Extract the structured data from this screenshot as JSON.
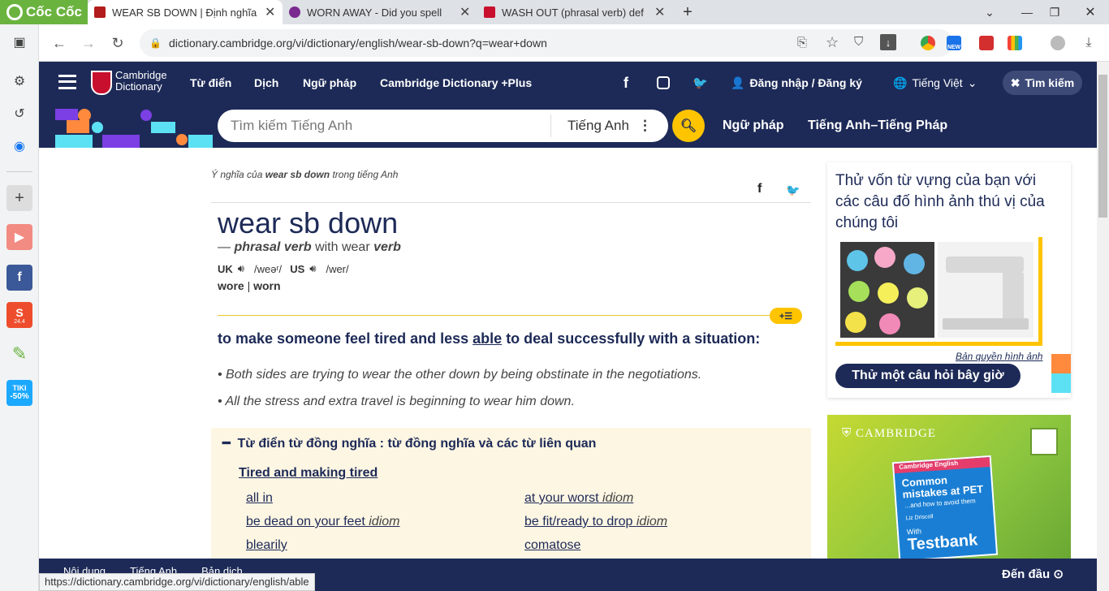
{
  "browser": {
    "brand": "Cốc Cốc",
    "tabs": [
      {
        "title": "WEAR SB DOWN | Định nghĩa"
      },
      {
        "title": "WORN AWAY - Did you spell"
      },
      {
        "title": "WASH OUT (phrasal verb) def"
      }
    ],
    "url": "dictionary.cambridge.org/vi/dictionary/english/wear-sb-down?q=wear+down",
    "status_url": "https://dictionary.cambridge.org/vi/dictionary/english/able",
    "ext_new_badge": "NEW"
  },
  "sidebar": {
    "shopee_badge": "24.4",
    "tiki_label": "TIKI",
    "tiki_discount": "-50%"
  },
  "header": {
    "brand_line1": "Cambridge",
    "brand_line2": "Dictionary",
    "nav": [
      "Từ điển",
      "Dịch",
      "Ngữ pháp",
      "Cambridge Dictionary +Plus"
    ],
    "login": "Đăng nhập / Đăng ký",
    "language": "Tiếng Việt",
    "search_toggle": "Tìm kiếm"
  },
  "subheader": {
    "search_placeholder": "Tìm kiếm Tiếng Anh",
    "dictionary_select": "Tiếng Anh",
    "links": [
      "Ngữ pháp",
      "Tiếng Anh–Tiếng Pháp"
    ]
  },
  "entry": {
    "breadcrumb_prefix": "Ý nghĩa của",
    "breadcrumb_word": "wear sb down",
    "breadcrumb_suffix": "trong tiếng Anh",
    "headword": "wear sb down",
    "dash": "—",
    "pos": "phrasal verb",
    "with_text": "with wear",
    "with_pos": "verb",
    "uk_label": "UK",
    "uk_ipa": "/weəʳ/",
    "us_label": "US",
    "us_ipa": "/wer/",
    "forms": [
      "wore",
      "worn"
    ],
    "def_before": "to make someone feel tired and less",
    "def_link": "able",
    "def_after": "to deal successfully with a situation:",
    "examples": [
      "Both sides are trying to wear the other down by being obstinate in the negotiations.",
      "All the stress and extra travel is beginning to wear him down."
    ]
  },
  "thesaurus": {
    "title": "Từ điển từ đồng nghĩa : từ đồng nghĩa và các từ liên quan",
    "group": "Tired and making tired",
    "left": [
      {
        "text": "all in",
        "tag": ""
      },
      {
        "text": "be dead on your feet",
        "tag": "idiom"
      },
      {
        "text": "blearily",
        "tag": ""
      }
    ],
    "right": [
      {
        "text": "at your worst",
        "tag": "idiom"
      },
      {
        "text": "be fit/ready to drop",
        "tag": "idiom"
      },
      {
        "text": "comatose",
        "tag": ""
      }
    ]
  },
  "quiz": {
    "text": "Thử vốn từ vựng của bạn với các câu đố hình ảnh thú vị của chúng tôi",
    "credit": "Bản quyền hình ảnh",
    "button": "Thử một câu hỏi bây giờ"
  },
  "ad": {
    "brand": "CAMBRIDGE",
    "book_series": "Cambridge English",
    "book_title": "Common mistakes at PET",
    "book_sub": "...and how to avoid them",
    "book_author": "Liz Driscoll",
    "book_with": "With",
    "book_brand": "Testbank"
  },
  "bottom": {
    "items": [
      "Nội dung",
      "Tiếng Anh",
      "Bản dịch"
    ],
    "back_to_top": "Đến đầu"
  }
}
